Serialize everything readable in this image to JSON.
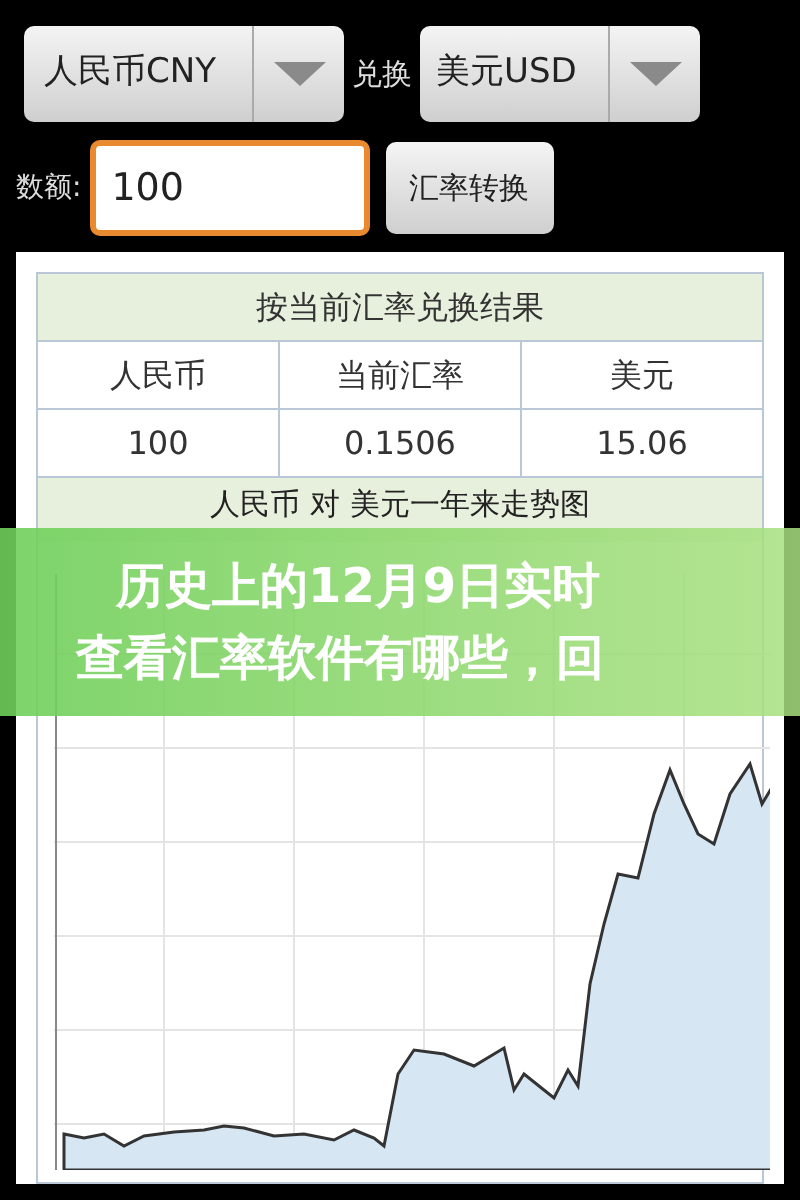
{
  "converter": {
    "from_currency": "人民币CNY",
    "exchange_label": "兑换",
    "to_currency": "美元USD",
    "amount_label": "数额:",
    "amount_value": "100",
    "convert_button": "汇率转换"
  },
  "result_table": {
    "title": "按当前汇率兑换结果",
    "columns": [
      "人民币",
      "当前汇率",
      "美元"
    ],
    "rows": [
      [
        "100",
        "0.1506",
        "15.06"
      ]
    ]
  },
  "chart": {
    "title": "人民币 对 美元一年来走势图"
  },
  "banner": {
    "lines": [
      "历史上的12月9日实时",
      "查看汇率软件有哪些，回"
    ]
  }
}
